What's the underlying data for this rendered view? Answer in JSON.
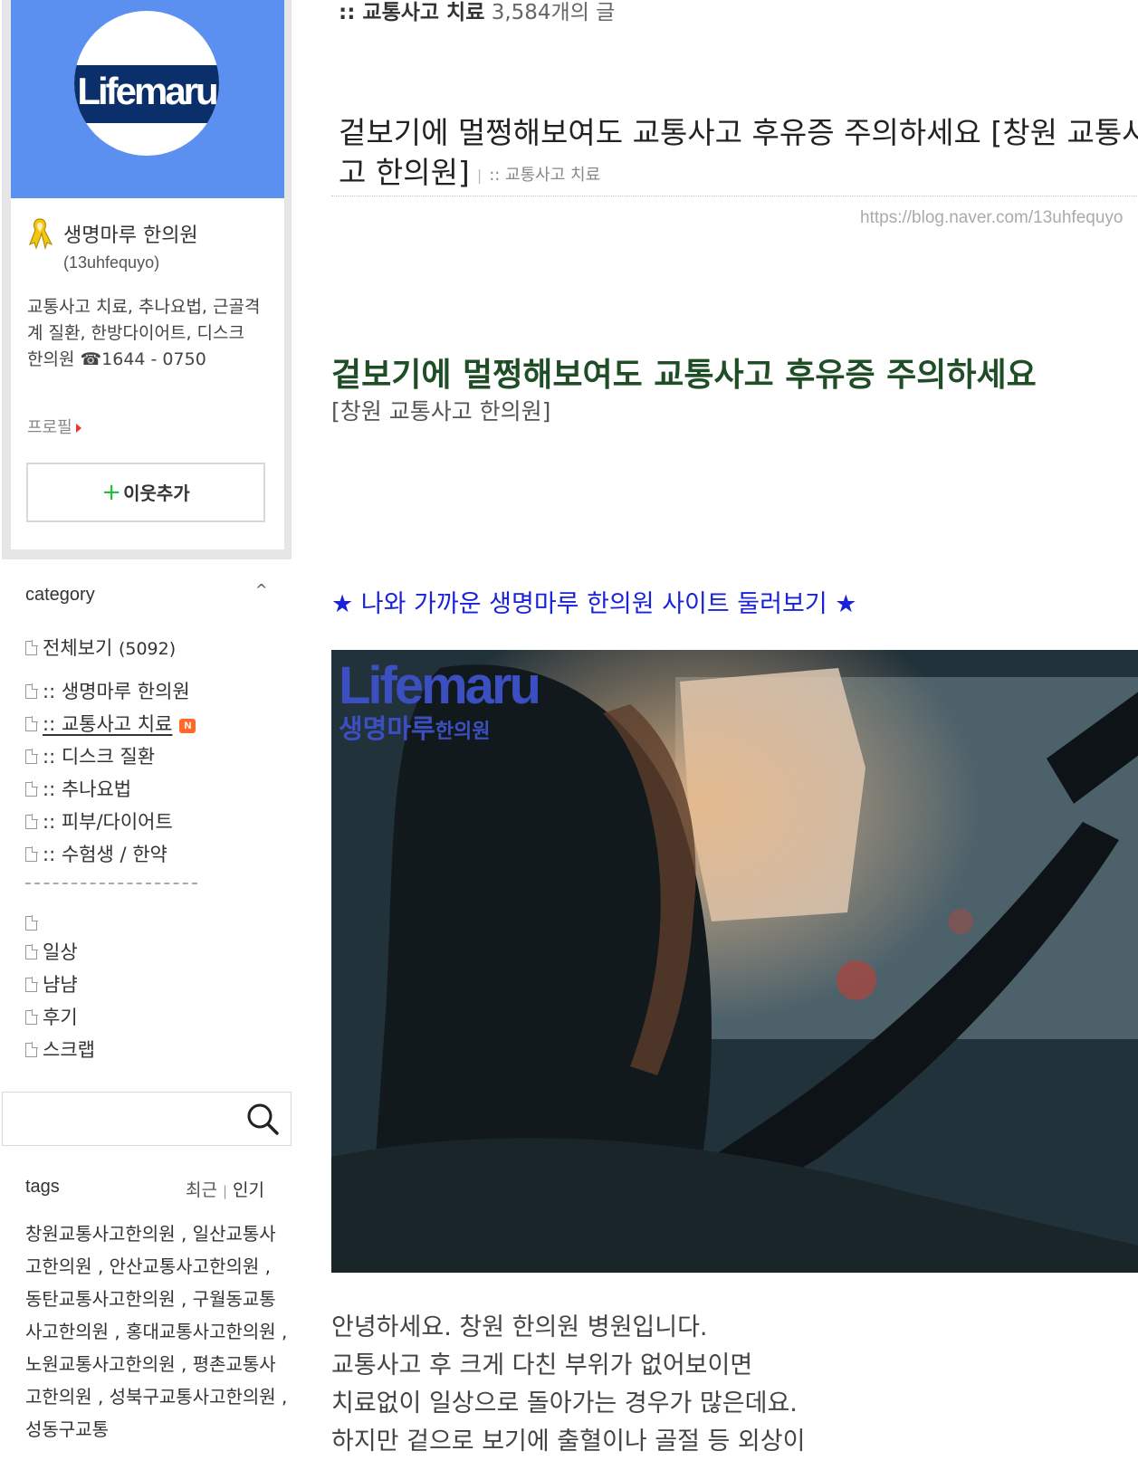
{
  "profile": {
    "logo_text": "Lifemaru",
    "name": "생명마루 한의원",
    "id": "(13uhfequyo)",
    "description": "교통사고 치료, 추나요법, 근골격계 질환, 한방다이어트, 디스크 한의원 ☎1644 - 0750",
    "profile_link": "프로필",
    "add_neighbor": "이웃추가",
    "add_neighbor_plus": "+",
    "banner_color": "#5b8ff0"
  },
  "category": {
    "title": "category",
    "toggle": "^",
    "all": {
      "label": "전체보기",
      "count": "(5092)"
    },
    "items": [
      {
        "label": ":: 생명마루 한의원"
      },
      {
        "label": ":: 교통사고 치료",
        "badge": "N"
      },
      {
        "label": ":: 디스크 질환"
      },
      {
        "label": ":: 추나요법"
      },
      {
        "label": ":: 피부/다이어트"
      },
      {
        "label": ":: 수험생 / 한약"
      }
    ],
    "extra_items": [
      {
        "label": ""
      },
      {
        "label": "일상"
      },
      {
        "label": "냠냠"
      },
      {
        "label": "후기"
      },
      {
        "label": "스크랩"
      }
    ]
  },
  "search": {
    "placeholder": ""
  },
  "tags": {
    "title": "tags",
    "sort_recent": "최근",
    "sort_popular": "인기",
    "list": "창원교통사고한의원 , 일산교통사고한의원 , 안산교통사고한의원 , 동탄교통사고한의원 , 구월동교통사고한의원 , 홍대교통사고한의원 , 노원교통사고한의원 , 평촌교통사고한의원 , 성북구교통사고한의원 , 성동구교통"
  },
  "board": {
    "name": ":: 교통사고 치료",
    "count_text": "3,584개의 글"
  },
  "post": {
    "title": "겉보기에 멀쩡해보여도 교통사고 후유증 주의하세요 [창원 교통사고 한의원]",
    "category_tag": ":: 교통사고 치료",
    "url": "https://blog.naver.com/13uhfequyo",
    "headline": "겉보기에 멀쩡해보여도 교통사고 후유증 주의하세요",
    "subhead": "[창원 교통사고 한의원]",
    "site_link": "★ 나와 가까운 생명마루 한의원 사이트 둘러보기 ★",
    "hero_logo_en": "Lifemaru",
    "hero_logo_ko": "생명마루",
    "hero_logo_ko_small": "한의원",
    "body_lines": [
      "안녕하세요. 창원 한의원 병원입니다.",
      "교통사고 후 크게 다친 부위가 없어보이면",
      "치료없이 일상으로 돌아가는 경우가 많은데요.",
      "하지만 겉으로 보기에 출혈이나 골절 등 외상이"
    ],
    "link_color": "#1a22d8",
    "headline_color": "#1e4d26"
  }
}
